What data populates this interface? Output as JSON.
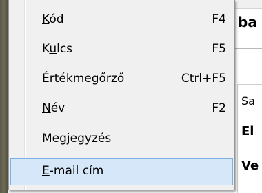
{
  "background_window": {
    "heading_text": "ba",
    "lines": [
      "Sa",
      "El",
      "Ve"
    ]
  },
  "context_menu": {
    "items": [
      {
        "label_pre": "",
        "label_mnemonic": "K",
        "label_post": "ód",
        "shortcut": "F4",
        "selected": false
      },
      {
        "label_pre": "K",
        "label_mnemonic": "u",
        "label_post": "lcs",
        "shortcut": "F5",
        "selected": false
      },
      {
        "label_pre": "",
        "label_mnemonic": "É",
        "label_post": "rtékmegőrző",
        "shortcut": "Ctrl+F5",
        "selected": false
      },
      {
        "label_pre": "",
        "label_mnemonic": "N",
        "label_post": "év",
        "shortcut": "F2",
        "selected": false
      },
      {
        "label_pre": "",
        "label_mnemonic": "M",
        "label_post": "egjegyzés",
        "shortcut": "",
        "selected": false
      },
      {
        "label_pre": "",
        "label_mnemonic": "E",
        "label_post": "-mail cím",
        "shortcut": "",
        "selected": true
      }
    ]
  },
  "colors": {
    "menu_background": "#f0f0f0",
    "selection_fill": "#d5e7f8",
    "selection_border": "#7bb0e3"
  }
}
